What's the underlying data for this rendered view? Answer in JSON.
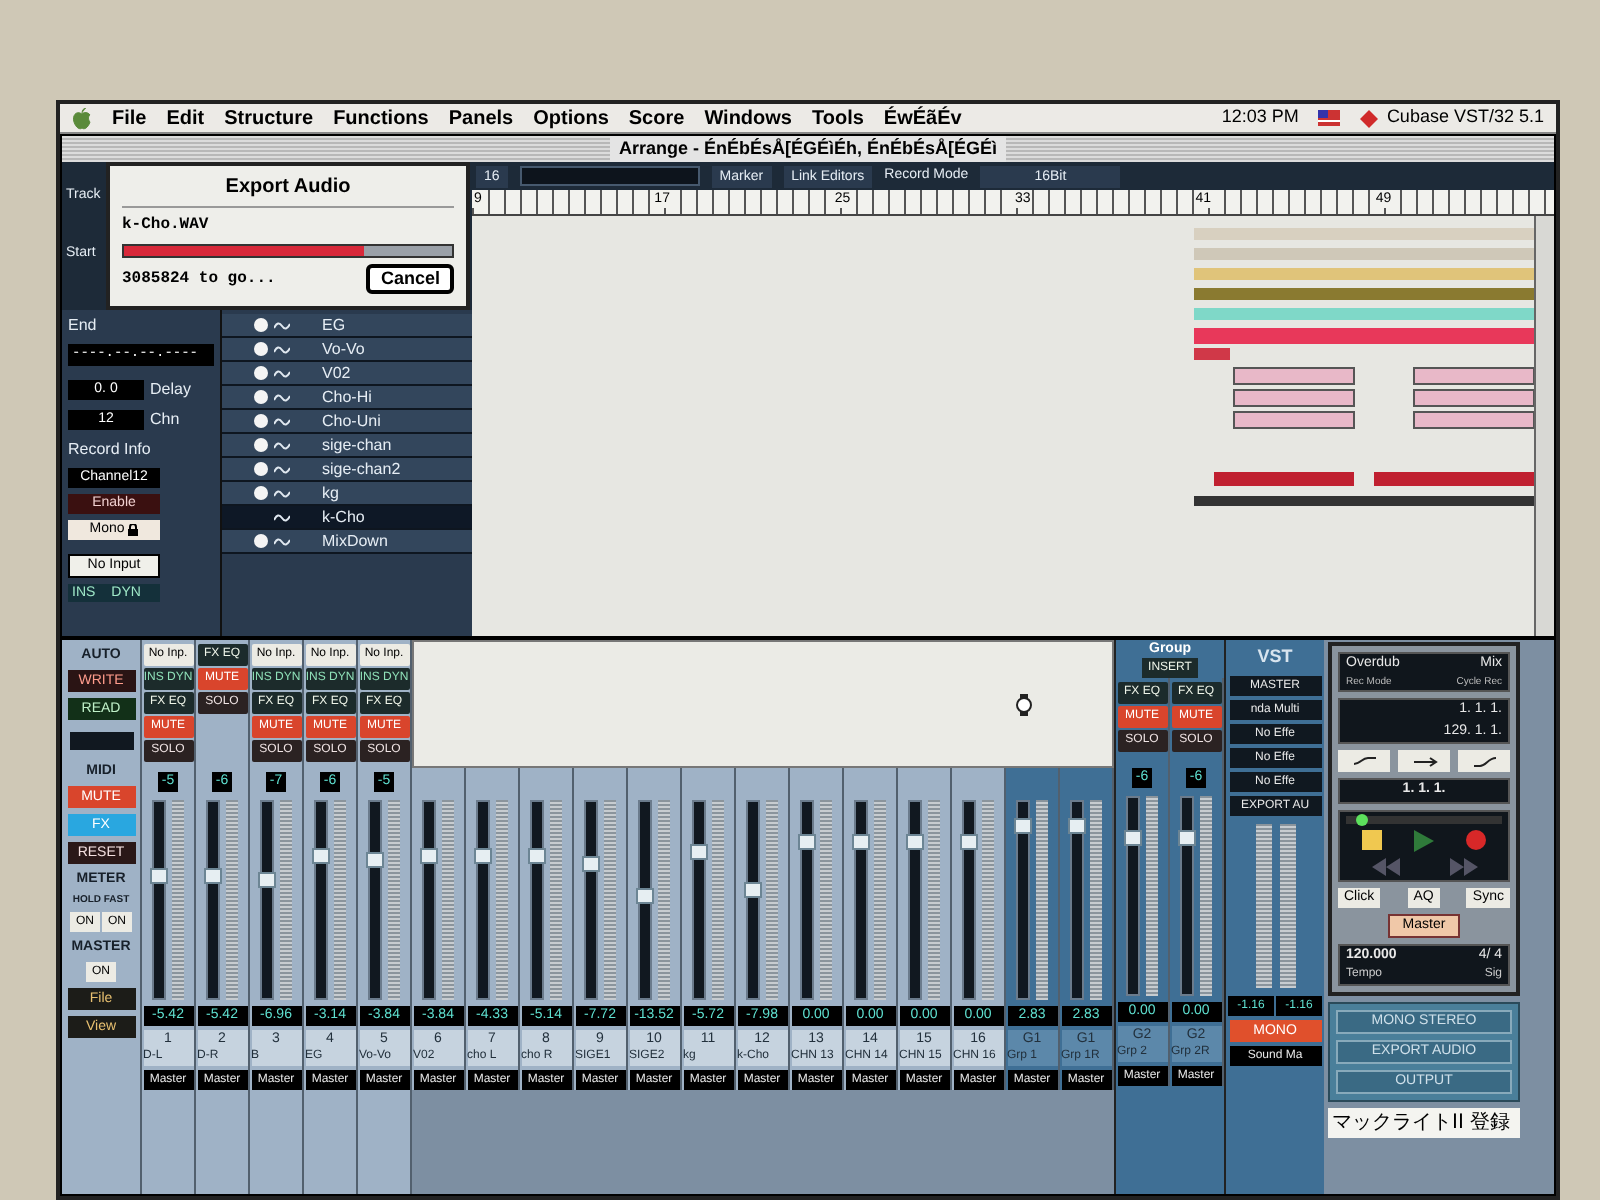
{
  "menu_bar": {
    "items": [
      "File",
      "Edit",
      "Structure",
      "Functions",
      "Panels",
      "Options",
      "Score",
      "Windows",
      "Tools",
      "ÉwÉãÉv"
    ],
    "clock": "12:03 PM",
    "app": "Cubase VST/32 5.1"
  },
  "arrange": {
    "title": "Arrange - ÉnÉbÉsÅ[ÉGÉìÉh, ÉnÉbÉsÅ[ÉGÉì",
    "toolbar": {
      "quantize": "16",
      "marker": "Marker",
      "link": "Link Editors",
      "record_mode": "Record Mode",
      "mode_value": "16Bit"
    },
    "ruler": [
      "9",
      "17",
      "25",
      "33",
      "41",
      "49"
    ],
    "side_labels": [
      "Track",
      "Start"
    ],
    "inspector": {
      "end_label": "End",
      "end_value": "----.--.--.----",
      "delay_value": "0. 0",
      "delay_label": "Delay",
      "chn_value": "12",
      "chn_label": "Chn",
      "record_info": "Record Info",
      "channel": "Channel12",
      "enable": "Enable",
      "mono": "Mono",
      "input": "No Input",
      "tabs": [
        "INS",
        "DYN"
      ]
    },
    "tracks": [
      {
        "name": "EG",
        "selected": false,
        "dot": true
      },
      {
        "name": "Vo-Vo",
        "selected": false,
        "dot": true
      },
      {
        "name": "V02",
        "selected": false,
        "dot": true
      },
      {
        "name": "Cho-Hi",
        "selected": false,
        "dot": true
      },
      {
        "name": "Cho-Uni",
        "selected": false,
        "dot": true
      },
      {
        "name": "sige-chan",
        "selected": false,
        "dot": true
      },
      {
        "name": "sige-chan2",
        "selected": false,
        "dot": true
      },
      {
        "name": "kg",
        "selected": false,
        "dot": true
      },
      {
        "name": "k-Cho",
        "selected": true,
        "dot": false
      },
      {
        "name": "MixDown",
        "selected": false,
        "dot": true
      }
    ]
  },
  "export_dialog": {
    "title": "Export Audio",
    "file": "k-Cho.WAV",
    "level": 0.73,
    "status": "3085824 to go...",
    "cancel": "Cancel"
  },
  "mixer": {
    "left_panel": [
      {
        "kind": "heading",
        "label": "AUTO"
      },
      {
        "kind": "write",
        "label": "WRITE"
      },
      {
        "kind": "read",
        "label": "READ"
      },
      {
        "kind": "blank"
      },
      {
        "kind": "heading",
        "label": "MIDI"
      },
      {
        "kind": "mute",
        "label": "MUTE"
      },
      {
        "kind": "fx",
        "label": "FX"
      },
      {
        "kind": "reset",
        "label": "RESET"
      },
      {
        "kind": "heading",
        "label": "METER"
      },
      {
        "kind": "small",
        "label": "HOLD FAST"
      },
      {
        "kind": "toggles",
        "labels": [
          "ON",
          "ON"
        ]
      },
      {
        "kind": "heading",
        "label": "MASTER"
      },
      {
        "kind": "toggles",
        "labels": [
          "ON"
        ]
      },
      {
        "kind": "menu",
        "label": "File"
      },
      {
        "kind": "menu",
        "label": "View"
      }
    ],
    "channels": [
      {
        "number": "1",
        "name": "D-L",
        "value": "-5.42",
        "reading": "-5",
        "level": 0.62,
        "output": "Master",
        "buttons": [
          {
            "kind": "input",
            "label": "No Inp."
          },
          {
            "kind": "insert",
            "label": "INS DYN"
          },
          {
            "kind": "fx",
            "label": "FX EQ"
          },
          {
            "kind": "mute",
            "label": "MUTE"
          },
          {
            "kind": "solo",
            "label": "SOLO"
          }
        ]
      },
      {
        "number": "2",
        "name": "D-R",
        "value": "-5.42",
        "reading": "-6",
        "level": 0.62,
        "output": "Master",
        "buttons": [
          {
            "kind": "fx",
            "label": "FX EQ"
          },
          {
            "kind": "mute",
            "label": "MUTE"
          },
          {
            "kind": "solo",
            "label": "SOLO"
          }
        ]
      },
      {
        "number": "3",
        "name": "B",
        "value": "-6.96",
        "reading": "-7",
        "level": 0.6,
        "output": "Master",
        "buttons": [
          {
            "kind": "input",
            "label": "No Inp."
          },
          {
            "kind": "insert",
            "label": "INS DYN"
          },
          {
            "kind": "fx",
            "label": "FX EQ"
          },
          {
            "kind": "mute",
            "label": "MUTE"
          },
          {
            "kind": "solo",
            "label": "SOLO"
          }
        ]
      },
      {
        "number": "4",
        "name": "EG",
        "value": "-3.14",
        "reading": "-6",
        "level": 0.72,
        "output": "Master",
        "buttons": [
          {
            "kind": "input",
            "label": "No Inp."
          },
          {
            "kind": "insert",
            "label": "INS DYN"
          },
          {
            "kind": "fx",
            "label": "FX EQ"
          },
          {
            "kind": "mute",
            "label": "MUTE"
          },
          {
            "kind": "solo",
            "label": "SOLO"
          }
        ]
      },
      {
        "number": "5",
        "name": "Vo-Vo",
        "value": "-3.84",
        "reading": "-5",
        "level": 0.7,
        "output": "Master",
        "buttons": [
          {
            "kind": "input",
            "label": "No Inp."
          },
          {
            "kind": "insert",
            "label": "INS DYN"
          },
          {
            "kind": "fx",
            "label": "FX EQ"
          },
          {
            "kind": "mute",
            "label": "MUTE"
          },
          {
            "kind": "solo",
            "label": "SOLO"
          }
        ]
      }
    ],
    "covered_channels": [
      {
        "number": "6",
        "name": "V02",
        "value": "-3.84",
        "level": 0.72,
        "output": "Master"
      },
      {
        "number": "7",
        "name": "cho L",
        "value": "-4.33",
        "level": 0.72,
        "output": "Master"
      },
      {
        "number": "8",
        "name": "cho R",
        "value": "-5.14",
        "level": 0.72,
        "output": "Master"
      },
      {
        "number": "9",
        "name": "SIGE1",
        "value": "-7.72",
        "level": 0.68,
        "output": "Master"
      },
      {
        "number": "10",
        "name": "SIGE2",
        "value": "-13.52",
        "level": 0.52,
        "output": "Master"
      },
      {
        "number": "11",
        "name": "kg",
        "value": "-5.72",
        "level": 0.74,
        "output": "Master"
      },
      {
        "number": "12",
        "name": "k-Cho",
        "value": "-7.98",
        "level": 0.55,
        "output": "Master"
      },
      {
        "number": "13",
        "name": "CHN 13",
        "value": "0.00",
        "level": 0.8,
        "output": "Master"
      },
      {
        "number": "14",
        "name": "CHN 14",
        "value": "0.00",
        "level": 0.8,
        "output": "Master"
      },
      {
        "number": "15",
        "name": "CHN 15",
        "value": "0.00",
        "level": 0.8,
        "output": "Master"
      },
      {
        "number": "16",
        "name": "CHN 16",
        "value": "0.00",
        "level": 0.8,
        "output": "Master"
      },
      {
        "number": "G1",
        "name": "Grp 1",
        "value": "2.83",
        "level": 0.88,
        "output": "Master"
      },
      {
        "number": "G1",
        "name": "Grp 1R",
        "value": "2.83",
        "level": 0.88,
        "output": "Master"
      }
    ],
    "group": {
      "title": "Group",
      "insert": "INSERT",
      "channels": [
        {
          "number": "G2",
          "name": "Grp 2",
          "value": "0.00",
          "reading": "-6",
          "level": 0.8,
          "output": "Master",
          "buttons": [
            {
              "kind": "fx",
              "label": "FX EQ"
            },
            {
              "kind": "mute",
              "label": "MUTE"
            },
            {
              "kind": "solo",
              "label": "SOLO"
            }
          ]
        },
        {
          "number": "G2",
          "name": "Grp 2R",
          "value": "0.00",
          "reading": "-6",
          "level": 0.8,
          "output": "Master",
          "buttons": [
            {
              "kind": "fx",
              "label": "FX EQ"
            },
            {
              "kind": "mute",
              "label": "MUTE"
            },
            {
              "kind": "solo",
              "label": "SOLO"
            }
          ]
        }
      ]
    },
    "master": {
      "title": "VST",
      "buttons": [
        "MASTER",
        "nda Multi",
        "No Effe",
        "No Effe",
        "No Effe",
        "EXPORT AU"
      ],
      "values": [
        "-1.16",
        "-1.16"
      ],
      "mono": "MONO",
      "output": "Sound Ma"
    },
    "output_panel": [
      "MONO STEREO",
      "EXPORT AUDIO",
      "OUTPUT"
    ]
  },
  "transport": {
    "mode": [
      "Overdub",
      "Mix"
    ],
    "mode_labels": [
      "Rec Mode",
      "Cycle Rec"
    ],
    "left": "1. 1. 1.",
    "right": "129. 1. 1.",
    "position": "1. 1. 1.",
    "level": 0.1,
    "buttons": [
      "Click",
      "AQ",
      "Sync"
    ],
    "master": "Master",
    "tempo": "120.000",
    "signature": "4/ 4",
    "tempo_label": "Tempo",
    "signature_label": "Sig"
  },
  "desktop_text": "マックライトII 登録"
}
